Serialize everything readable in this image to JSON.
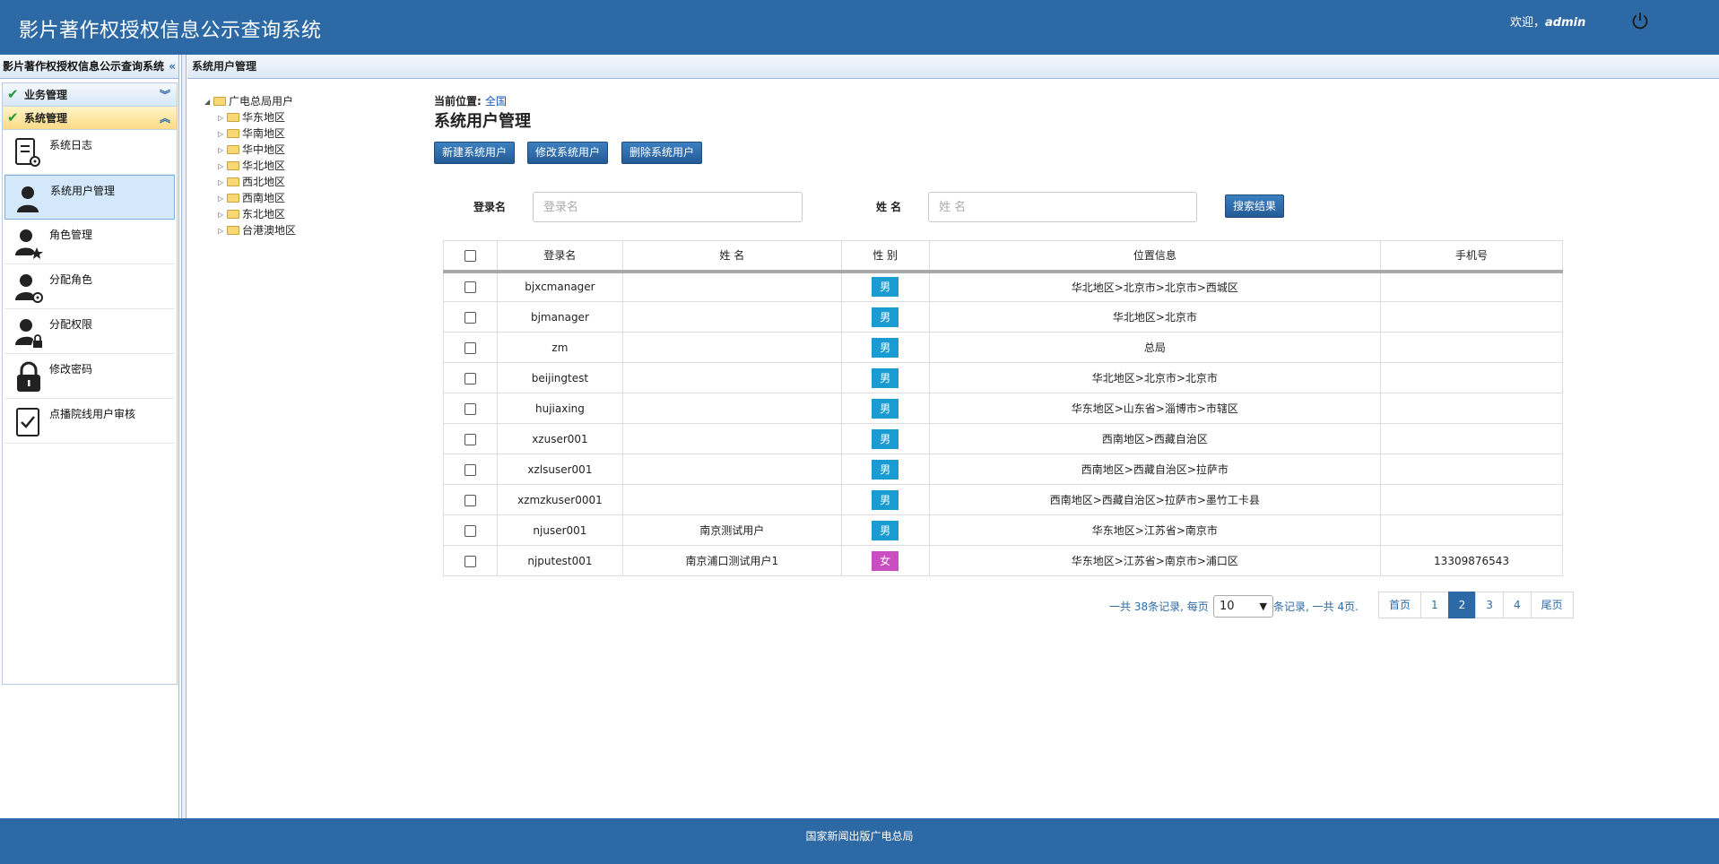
{
  "header": {
    "title": "影片著作权授权信息公示查询系统",
    "welcome_prefix": "欢迎，",
    "user": "admin",
    "power_icon": "power-icon"
  },
  "sidebar": {
    "title": "影片著作权授权信息公示查询系统",
    "collapse": "«",
    "groups": [
      {
        "label": "业务管理",
        "arrow": "︾"
      },
      {
        "label": "系统管理",
        "arrow": "︽"
      }
    ],
    "items": [
      {
        "label": "系统日志",
        "icon": "log-settings-icon"
      },
      {
        "label": "系统用户管理",
        "icon": "user-icon"
      },
      {
        "label": "角色管理",
        "icon": "user-star-icon"
      },
      {
        "label": "分配角色",
        "icon": "user-gear-icon"
      },
      {
        "label": "分配权限",
        "icon": "user-lock-icon"
      },
      {
        "label": "修改密码",
        "icon": "lock-icon"
      },
      {
        "label": "点播院线用户审核",
        "icon": "check-document-icon"
      }
    ]
  },
  "main": {
    "title": "系统用户管理"
  },
  "tree": {
    "root": "广电总局用户",
    "children": [
      "华东地区",
      "华南地区",
      "华中地区",
      "华北地区",
      "西北地区",
      "西南地区",
      "东北地区",
      "台港澳地区"
    ]
  },
  "content": {
    "crumb_label": "当前位置:",
    "crumb_value": "全国",
    "title": "系统用户管理",
    "buttons": {
      "new": "新建系统用户",
      "edit": "修改系统用户",
      "delete": "删除系统用户"
    },
    "search": {
      "login_label": "登录名",
      "login_placeholder": "登录名",
      "name_label": "姓 名",
      "name_placeholder": "姓 名",
      "submit": "搜索结果"
    }
  },
  "table": {
    "headers": [
      "登录名",
      "姓 名",
      "性 别",
      "位置信息",
      "手机号"
    ],
    "rows": [
      {
        "login": "bjxcmanager",
        "name": "",
        "sex": "男",
        "location": "华北地区>北京市>北京市>西城区",
        "phone": ""
      },
      {
        "login": "bjmanager",
        "name": "",
        "sex": "男",
        "location": "华北地区>北京市",
        "phone": ""
      },
      {
        "login": "zm",
        "name": "",
        "sex": "男",
        "location": "总局",
        "phone": ""
      },
      {
        "login": "beijingtest",
        "name": "",
        "sex": "男",
        "location": "华北地区>北京市>北京市",
        "phone": ""
      },
      {
        "login": "hujiaxing",
        "name": "",
        "sex": "男",
        "location": "华东地区>山东省>淄博市>市辖区",
        "phone": ""
      },
      {
        "login": "xzuser001",
        "name": "",
        "sex": "男",
        "location": "西南地区>西藏自治区",
        "phone": ""
      },
      {
        "login": "xzlsuser001",
        "name": "",
        "sex": "男",
        "location": "西南地区>西藏自治区>拉萨市",
        "phone": ""
      },
      {
        "login": "xzmzkuser0001",
        "name": "",
        "sex": "男",
        "location": "西南地区>西藏自治区>拉萨市>墨竹工卡县",
        "phone": ""
      },
      {
        "login": "njuser001",
        "name": "南京测试用户",
        "sex": "男",
        "location": "华东地区>江苏省>南京市",
        "phone": ""
      },
      {
        "login": "njputest001",
        "name": "南京浦口测试用户1",
        "sex": "女",
        "location": "华东地区>江苏省>南京市>浦口区",
        "phone": "13309876543"
      }
    ]
  },
  "pager": {
    "info_left": "一共 38条记录, 每页",
    "page_size": "10",
    "info_right": "条记录, 一共 4页.",
    "first": "首页",
    "pages": [
      "1",
      "2",
      "3",
      "4"
    ],
    "current": "2",
    "last": "尾页"
  },
  "footer": {
    "text": "国家新闻出版广电总局"
  },
  "colors": {
    "primary": "#2d6aa5",
    "male": "#1a9bd1",
    "female": "#c94ec1"
  }
}
